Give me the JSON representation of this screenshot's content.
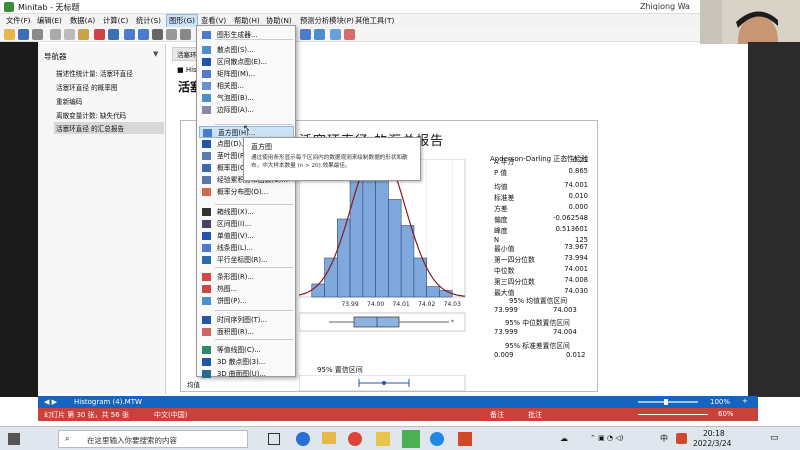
{
  "window": {
    "title": "Minitab - 无标题",
    "user": "Zhiqiong Wa"
  },
  "menu": [
    {
      "label": "文件(F)"
    },
    {
      "label": "编辑(E)"
    },
    {
      "label": "数据(A)"
    },
    {
      "label": "计算(C)"
    },
    {
      "label": "统计(S)"
    },
    {
      "label": "图形(G)"
    },
    {
      "label": "查看(V)"
    },
    {
      "label": "帮助(H)"
    },
    {
      "label": "协助(N)"
    },
    {
      "label": "预测分析模块(P)"
    },
    {
      "label": "其他工具(T)"
    }
  ],
  "navigator": {
    "title": "导航器",
    "items": [
      {
        "label": "描述性统计量: 活塞环直径"
      },
      {
        "label": "活塞环直径 的概率图"
      },
      {
        "label": "重新编码"
      },
      {
        "label": "离散变量计数: 缺失代码"
      },
      {
        "label": "活塞环直径 的汇总报告"
      }
    ]
  },
  "doc": {
    "tab1": "活塞环...",
    "tab_sub": "Histo",
    "heading": "活塞",
    "report_title": "活塞环直径 的汇总报告"
  },
  "dropdown": {
    "items": [
      {
        "label": "图形生成器...",
        "icon": "graph-builder-icon"
      },
      {
        "label": "散点图(S)...",
        "icon": "scatter-icon"
      },
      {
        "label": "区间散点图(E)...",
        "icon": "interval-scatter-icon"
      },
      {
        "label": "矩阵图(M)...",
        "icon": "matrix-icon"
      },
      {
        "label": "相关图...",
        "icon": "correlation-icon"
      },
      {
        "label": "气泡图(B)...",
        "icon": "bubble-icon"
      },
      {
        "label": "边际图(A)...",
        "icon": "marginal-icon"
      },
      {
        "label": "直方图(H)...",
        "icon": "histogram-icon"
      },
      {
        "label": "点图(D)...",
        "icon": "dotplot-icon"
      },
      {
        "label": "茎叶图(F)...",
        "icon": "stemleaf-icon"
      },
      {
        "label": "概率图(O)...",
        "icon": "probability-icon"
      },
      {
        "label": "经验累积分布函数(C)...",
        "icon": "ecdf-icon"
      },
      {
        "label": "概率分布图(O)...",
        "icon": "distribution-icon"
      },
      {
        "label": "箱线图(X)...",
        "icon": "boxplot-icon"
      },
      {
        "label": "区间图(I)...",
        "icon": "interval-icon"
      },
      {
        "label": "单值图(V)...",
        "icon": "individual-value-icon"
      },
      {
        "label": "线条图(L)...",
        "icon": "line-plot-icon"
      },
      {
        "label": "平行坐标图(R)...",
        "icon": "parallel-icon"
      },
      {
        "label": "条形图(R)...",
        "icon": "bar-chart-icon"
      },
      {
        "label": "热图...",
        "icon": "heatmap-icon"
      },
      {
        "label": "饼图(P)...",
        "icon": "pie-icon"
      },
      {
        "label": "时间序列图(T)...",
        "icon": "timeseries-icon"
      },
      {
        "label": "面积图(R)...",
        "icon": "area-icon"
      },
      {
        "label": "等值线图(C)...",
        "icon": "contour-icon"
      },
      {
        "label": "3D 散点图(3)...",
        "icon": "3d-scatter-icon"
      },
      {
        "label": "3D 曲面图(U)...",
        "icon": "3d-surface-icon"
      }
    ]
  },
  "tooltip": {
    "title": "直方图",
    "body": "通过使用条形显示每个区间内的数据观测来绘制数据的形状和散布。中大样本数量 (n > 20) 效果最佳。"
  },
  "stats": {
    "title": "Anderson-Darling 正态性检验",
    "rows": [
      {
        "k": "A 平方",
        "v": "0.21"
      },
      {
        "k": "P 值",
        "v": "0.865"
      },
      {
        "k": "均值",
        "v": "74.001"
      },
      {
        "k": "标准差",
        "v": "0.010"
      },
      {
        "k": "方差",
        "v": "0.000"
      },
      {
        "k": "偏度",
        "v": "-0.062548"
      },
      {
        "k": "峰度",
        "v": "0.513601"
      },
      {
        "k": "N",
        "v": "125"
      },
      {
        "k": "最小值",
        "v": "73.967"
      },
      {
        "k": "第一四分位数",
        "v": "73.994"
      },
      {
        "k": "中位数",
        "v": "74.001"
      },
      {
        "k": "第三四分位数",
        "v": "74.008"
      },
      {
        "k": "最大值",
        "v": "74.030"
      }
    ],
    "ci_mean_title": "95% 均值置信区间",
    "ci_mean": [
      "73.999",
      "74.003"
    ],
    "ci_median_title": "95% 中位数置信区间",
    "ci_median": [
      "73.999",
      "74.004"
    ],
    "ci_sd_title": "95% 标准差置信区间",
    "ci_sd": [
      "0.009",
      "0.012"
    ],
    "ci_plot_title": "95% 置信区间",
    "ci_plot_label": "均值"
  },
  "chart_data": {
    "type": "bar",
    "xlabel": "",
    "ylabel": "",
    "ticks": [
      "73.99",
      "74.00",
      "74.01",
      "74.02",
      "74.03"
    ],
    "bin_starts": [
      73.975,
      73.98,
      73.985,
      73.99,
      73.995,
      74.0,
      74.005,
      74.01,
      74.015,
      74.02,
      74.025
    ],
    "values": [
      0.1,
      0.3,
      0.6,
      0.9,
      1.0,
      1.0,
      0.75,
      0.55,
      0.3,
      0.08,
      0.05
    ],
    "xlim": [
      73.97,
      74.035
    ],
    "normal_curve": true
  },
  "statusbar": {
    "tab_name": "Histogram (4).MTW",
    "slide": "幻灯片 第 30 张，共 56 张",
    "lang": "中文(中国)",
    "notes": "备注",
    "comments": "批注",
    "zoom": "100%",
    "zoom2": "60%"
  },
  "taskbar": {
    "search_placeholder": "在这里输入你要搜索的内容",
    "time": "20:18",
    "date": "2022/3/24",
    "ime": "中",
    "temp": "18"
  }
}
